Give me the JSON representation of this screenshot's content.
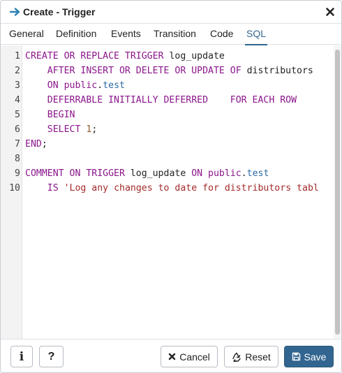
{
  "dialog": {
    "title": "Create - Trigger",
    "icon": "arrow-right-icon",
    "close_icon": "close-icon"
  },
  "tabs": [
    {
      "label": "General",
      "active": false
    },
    {
      "label": "Definition",
      "active": false
    },
    {
      "label": "Events",
      "active": false
    },
    {
      "label": "Transition",
      "active": false
    },
    {
      "label": "Code",
      "active": false
    },
    {
      "label": "SQL",
      "active": true
    }
  ],
  "sql_lines": [
    {
      "n": "1",
      "parts": [
        [
          "kw",
          "CREATE OR REPLACE TRIGGER"
        ],
        [
          "t",
          " log_update"
        ]
      ]
    },
    {
      "n": "2",
      "parts": [
        [
          "t",
          "    "
        ],
        [
          "kw",
          "AFTER INSERT OR DELETE OR UPDATE OF"
        ],
        [
          "t",
          " distributors"
        ]
      ]
    },
    {
      "n": "3",
      "parts": [
        [
          "t",
          "    "
        ],
        [
          "kw",
          "ON public"
        ],
        [
          "t",
          "."
        ],
        [
          "var",
          "test"
        ]
      ]
    },
    {
      "n": "4",
      "parts": [
        [
          "t",
          "    "
        ],
        [
          "kw",
          "DEFERRABLE INITIALLY DEFERRED"
        ],
        [
          "t",
          "    "
        ],
        [
          "kw",
          "FOR EACH ROW"
        ]
      ]
    },
    {
      "n": "5",
      "parts": [
        [
          "t",
          "    "
        ],
        [
          "kw",
          "BEGIN"
        ]
      ]
    },
    {
      "n": "6",
      "parts": [
        [
          "t",
          "    "
        ],
        [
          "kw",
          "SELECT"
        ],
        [
          "t",
          " "
        ],
        [
          "num",
          "1"
        ],
        [
          "t",
          ";"
        ]
      ]
    },
    {
      "n": "7",
      "parts": [
        [
          "kw",
          "END"
        ],
        [
          "t",
          ";"
        ]
      ]
    },
    {
      "n": "8",
      "parts": []
    },
    {
      "n": "9",
      "parts": [
        [
          "kw",
          "COMMENT ON TRIGGER"
        ],
        [
          "t",
          " log_update "
        ],
        [
          "kw",
          "ON public"
        ],
        [
          "t",
          "."
        ],
        [
          "var",
          "test"
        ]
      ]
    },
    {
      "n": "10",
      "parts": [
        [
          "t",
          "    "
        ],
        [
          "kw",
          "IS"
        ],
        [
          "t",
          " "
        ],
        [
          "str",
          "'Log any changes to date for distributors tabl"
        ]
      ]
    }
  ],
  "footer": {
    "info_label": "i",
    "help_label": "?",
    "cancel_label": "Cancel",
    "reset_label": "Reset",
    "save_label": "Save"
  },
  "colors": {
    "accent": "#326690",
    "keyword": "#8b168b",
    "identifier": "#2a6aa5",
    "string": "#a32a2a",
    "number": "#8c5a2a"
  }
}
